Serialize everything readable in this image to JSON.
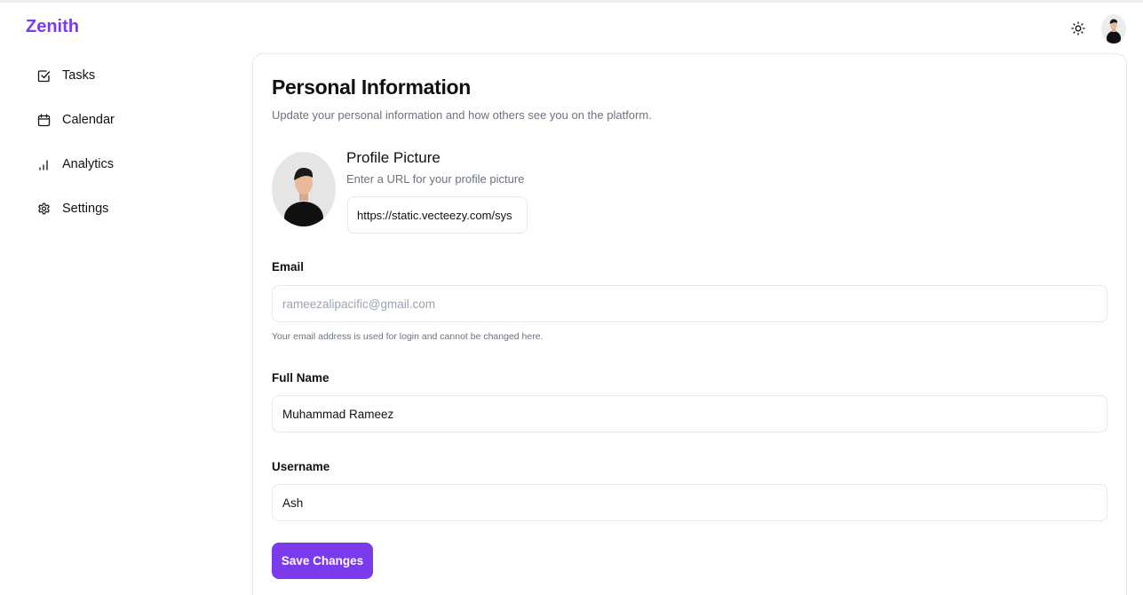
{
  "app": {
    "name": "Zenith"
  },
  "colors": {
    "brand": "#7c3aed",
    "muted_text": "#6b7280",
    "border": "#e5e7eb"
  },
  "header": {
    "theme_toggle_icon": "sun-icon",
    "avatar_icon": "user-avatar"
  },
  "sidebar": {
    "items": [
      {
        "label": "Tasks",
        "icon": "checkbox-icon"
      },
      {
        "label": "Calendar",
        "icon": "calendar-icon"
      },
      {
        "label": "Analytics",
        "icon": "bar-chart-icon"
      },
      {
        "label": "Settings",
        "icon": "gear-icon"
      }
    ]
  },
  "main": {
    "title": "Personal Information",
    "subtitle": "Update your personal information and how others see you on the platform.",
    "profile_picture": {
      "title": "Profile Picture",
      "help": "Enter a URL for your profile picture",
      "value": "https://static.vecteezy.com/sys"
    },
    "email": {
      "label": "Email",
      "value": "rameezalipacific@gmail.com",
      "help": "Your email address is used for login and cannot be changed here."
    },
    "full_name": {
      "label": "Full Name",
      "value": "Muhammad Rameez"
    },
    "username": {
      "label": "Username",
      "value": "Ash"
    },
    "save_label": "Save Changes"
  }
}
